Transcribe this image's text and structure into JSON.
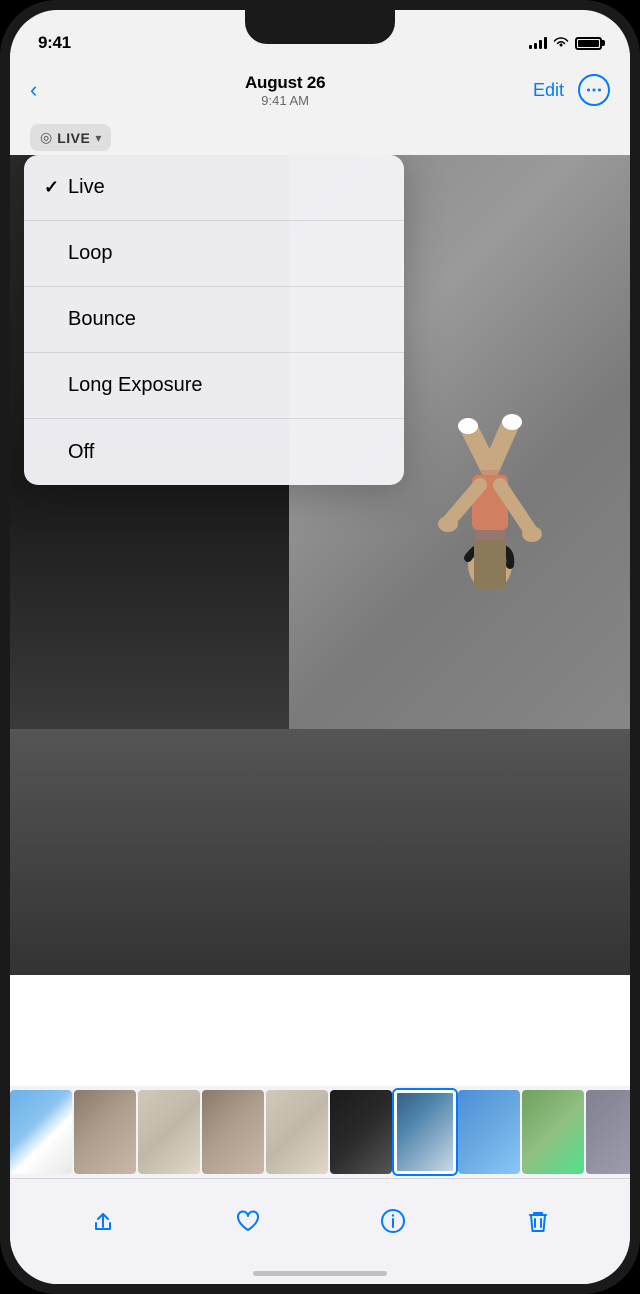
{
  "statusBar": {
    "time": "9:41",
    "signals": 4,
    "wifi": true,
    "battery": 100
  },
  "navBar": {
    "backLabel": "",
    "title": "August 26",
    "subtitle": "9:41 AM",
    "editLabel": "Edit",
    "moreLabel": "⋯"
  },
  "liveBadge": {
    "icon": "◎",
    "label": "LIVE",
    "chevron": "⌄"
  },
  "dropdown": {
    "items": [
      {
        "id": "live",
        "label": "Live",
        "selected": true
      },
      {
        "id": "loop",
        "label": "Loop",
        "selected": false
      },
      {
        "id": "bounce",
        "label": "Bounce",
        "selected": false
      },
      {
        "id": "long-exposure",
        "label": "Long Exposure",
        "selected": false
      },
      {
        "id": "off",
        "label": "Off",
        "selected": false
      }
    ]
  },
  "actionBar": {
    "share": "share",
    "like": "heart",
    "info": "info",
    "delete": "trash"
  }
}
